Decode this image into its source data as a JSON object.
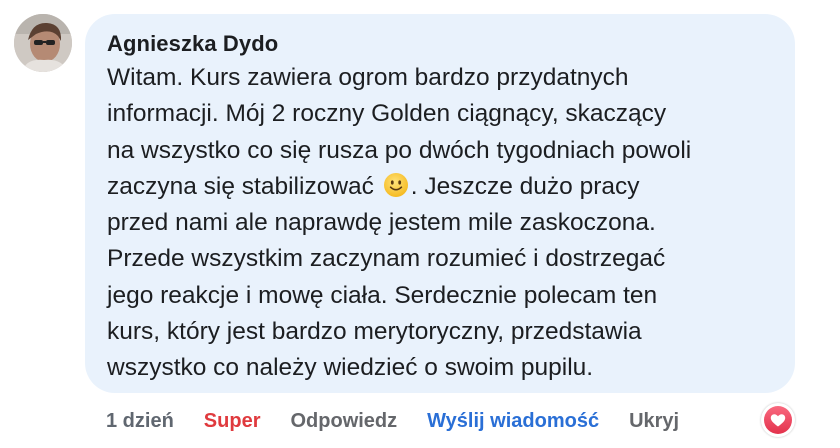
{
  "comment": {
    "author": "Agnieszka Dydo",
    "text_lines": [
      "Witam. Kurs zawiera ogrom bardzo przydatnych",
      "informacji. Mój 2 roczny Golden ciągnący, skaczący",
      "na wszystko co się rusza po dwóch tygodniach powoli",
      "zaczyna się stabilizować",
      ". Jeszcze dużo pracy",
      "przed nami ale naprawdę jestem mile zaskoczona.",
      "Przede wszystkim zaczynam rozumieć i dostrzegać",
      "jego reakcje i mowę ciała. Serdecznie polecam ten",
      "kurs, który jest bardzo merytoryczny, przedstawia",
      "wszystko co należy wiedzieć o swoim pupilu."
    ],
    "inline_emoji": "slightly-smiling-face-icon"
  },
  "actions": {
    "time": "1 dzień",
    "reaction_label": "Super",
    "reply_label": "Odpowiedz",
    "message_label": "Wyślij wiadomość",
    "hide_label": "Ukryj"
  },
  "reaction_badge": {
    "icon": "heart-icon",
    "color": "#f33e58"
  },
  "colors": {
    "bubble_background": "#e9f2fc",
    "text": "#1c1e21",
    "reaction_active": "#e03a3e",
    "message_link": "#2a6fd6",
    "muted": "#65676b"
  }
}
